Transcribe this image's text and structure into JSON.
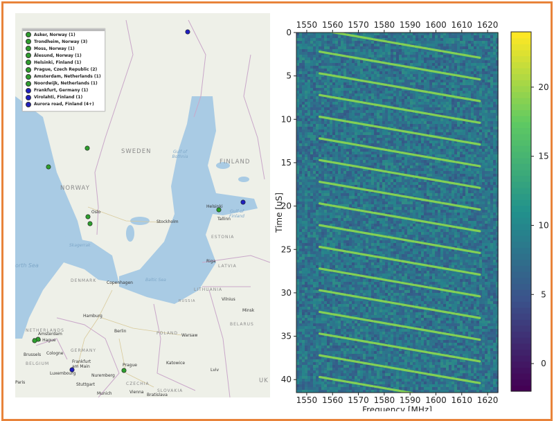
{
  "colors": {
    "frame": "#e8833a",
    "finland_site": "#1f1fbf",
    "other_site": "#2e9e2e",
    "land": "#eef0e8",
    "water": "#a9cbe4"
  },
  "map": {
    "legend": [
      {
        "label": "Asker, Norway (1)",
        "color": "#2e9e2e"
      },
      {
        "label": "Trondheim, Norway (3)",
        "color": "#2e9e2e"
      },
      {
        "label": "Moss, Norway (1)",
        "color": "#2e9e2e"
      },
      {
        "label": "Ålesund, Norway (1)",
        "color": "#2e9e2e"
      },
      {
        "label": "Helsinki, Finland (1)",
        "color": "#2e9e2e"
      },
      {
        "label": "Prague, Czech Republic (2)",
        "color": "#2e9e2e"
      },
      {
        "label": "Amsterdam, Netherlands (1)",
        "color": "#2e9e2e"
      },
      {
        "label": "Noordwijk, Netherlands (1)",
        "color": "#2e9e2e"
      },
      {
        "label": "Frankfurt, Germany (1)",
        "color": "#1f1fbf"
      },
      {
        "label": "Virolahti, Finland (1)",
        "color": "#1f1fbf"
      },
      {
        "label": "Aurora road, Finland (4+)",
        "color": "#1f1fbf"
      }
    ],
    "countries": {
      "sweden": "SWEDEN",
      "finland": "FINLAND",
      "norway": "NORWAY",
      "estonia": "ESTONIA",
      "latvia": "LATVIA",
      "lithuania": "LITHUANIA",
      "denmark": "DENMARK",
      "netherlands": "NETHERLANDS",
      "germany": "GERMANY",
      "poland": "POLAND",
      "belarus": "BELARUS",
      "czechia": "CZECHIA",
      "slovakia": "SLOVAKIA",
      "belgium": "BELGIUM",
      "russia": "RUSSIA",
      "uk": "UK"
    },
    "seas": {
      "bothnia": "Gulf of Bothnia",
      "finland_gulf": "Gulf of Finland",
      "skagerrak": "Skagerrak",
      "north_sea": "orth Sea",
      "baltic": "Baltic Sea"
    },
    "cities": {
      "oslo": "Oslo",
      "stockholm": "Stockholm",
      "helsinki": "Helsinki",
      "tallinn": "Tallinn",
      "riga": "Riga",
      "copenhagen": "Copenhagen",
      "vilnius": "Vilnius",
      "minsk": "Minsk",
      "hamburg": "Hamburg",
      "berlin": "Berlin",
      "warsaw": "Warsaw",
      "amsterdam": "Amsterdam",
      "the_hague": "The Hague",
      "brussels": "Brussels",
      "cologne": "Cologne",
      "frankfurt": "Frankfurt am Main",
      "luxembourg": "Luxembourg",
      "prague": "Prague",
      "nuremberg": "Nuremberg",
      "stuttgart": "Stuttgart",
      "munich": "Munich",
      "vienna": "Vienna",
      "bratislava": "Bratislava",
      "katowice": "Katowice",
      "lviv": "Lviv",
      "paris": "Paris"
    }
  },
  "chart_data": {
    "type": "heatmap",
    "title": "",
    "xlabel": "Frequency [MHz]",
    "ylabel": "Time [uS]",
    "xlim": [
      1546,
      1624
    ],
    "ylim": [
      41.5,
      0
    ],
    "xticks": [
      1550,
      1560,
      1570,
      1580,
      1590,
      1600,
      1610,
      1620
    ],
    "yticks": [
      0,
      5,
      10,
      15,
      20,
      25,
      30,
      35,
      40
    ],
    "x_tick_labels_top_and_bottom": true,
    "colorbar": {
      "ticks": [
        0,
        5,
        10,
        15,
        20
      ],
      "range": [
        -2,
        24
      ],
      "colormap": "viridis"
    },
    "background_level": 8,
    "chirp_level": 19,
    "chirp_period_us": 2.5,
    "chirp_freq_start_mhz": 1555,
    "chirp_freq_end_mhz": 1617,
    "chirp_time_span_us": 3.2,
    "chirp_start_times_us": [
      -0.3,
      2.2,
      4.7,
      7.2,
      9.7,
      12.2,
      14.7,
      17.2,
      19.7,
      22.2,
      24.7,
      27.2,
      29.7,
      32.2,
      34.7,
      37.2,
      39.7
    ]
  }
}
